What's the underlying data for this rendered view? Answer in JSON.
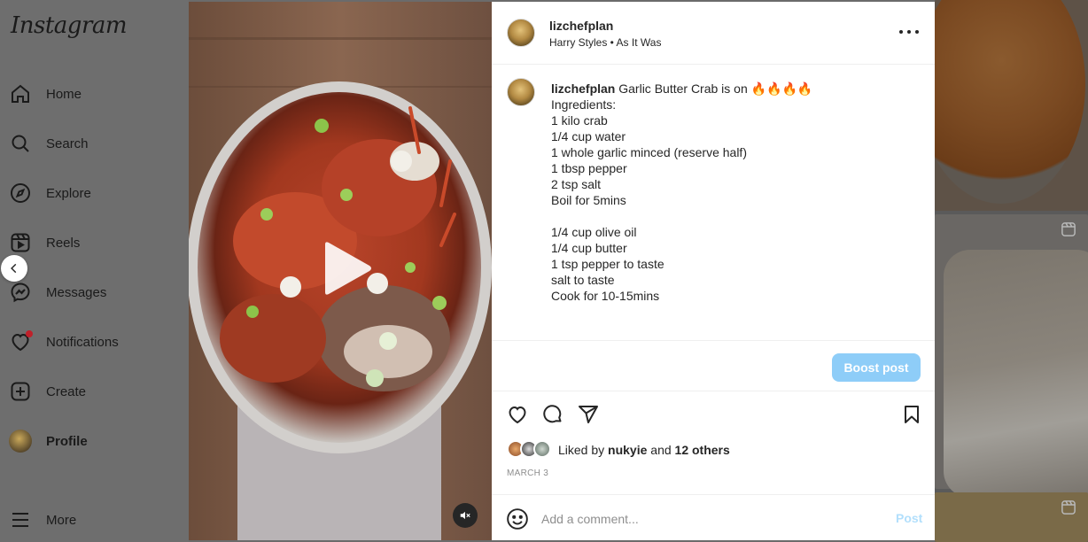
{
  "app": {
    "logo": "Instagram"
  },
  "sidebar": {
    "items": [
      {
        "label": "Home",
        "icon": "home-icon"
      },
      {
        "label": "Search",
        "icon": "search-icon"
      },
      {
        "label": "Explore",
        "icon": "compass-icon"
      },
      {
        "label": "Reels",
        "icon": "reels-icon"
      },
      {
        "label": "Messages",
        "icon": "messenger-icon"
      },
      {
        "label": "Notifications",
        "icon": "heart-icon"
      },
      {
        "label": "Create",
        "icon": "plus-square-icon"
      },
      {
        "label": "Profile",
        "icon": "avatar"
      },
      {
        "label": "More",
        "icon": "menu-icon"
      }
    ]
  },
  "post": {
    "username": "lizchefplan",
    "audio": "Harry Styles • As It Was",
    "caption_title": "Garlic Butter Crab is on 🔥🔥🔥🔥",
    "caption_body": "\nIngredients:\n1 kilo crab\n1/4 cup water\n1 whole garlic minced (reserve half)\n1 tbsp pepper\n2 tsp salt\nBoil for 5mins\n\n1/4 cup olive oil\n1/4 cup butter\n1 tsp pepper to taste\nsalt to taste\nCook for 10-15mins",
    "boost_label": "Boost post",
    "likes": {
      "prefix": "Liked by",
      "user": "nukyie",
      "joiner": "and",
      "others": "12 others"
    },
    "date": "MARCH 3",
    "comment_placeholder": "Add a comment...",
    "post_label": "Post"
  },
  "colors": {
    "accent": "#0095f6",
    "boost": "#8ecdf8",
    "post_disabled": "#b2dffc",
    "notification_dot": "#ff3040"
  }
}
